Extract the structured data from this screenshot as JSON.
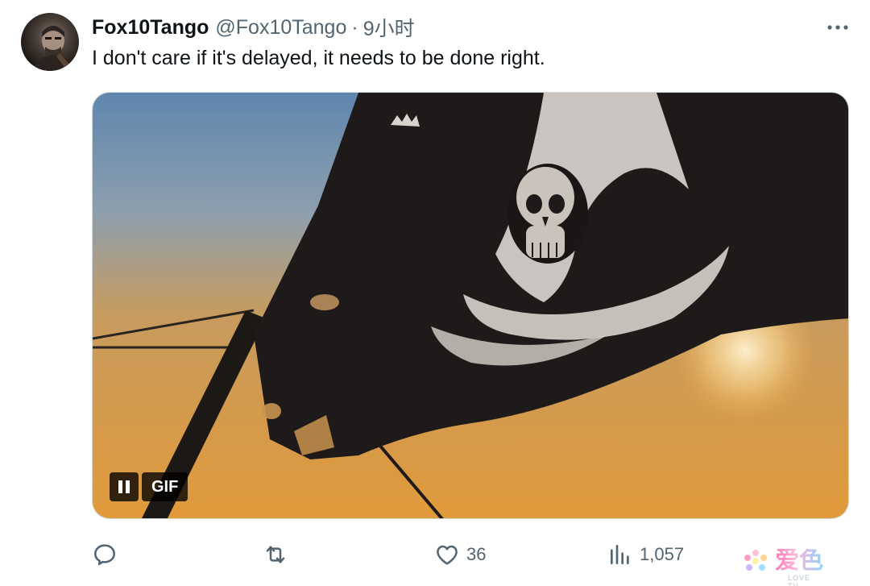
{
  "tweet": {
    "display_name": "Fox10Tango",
    "handle": "@Fox10Tango",
    "separator": "·",
    "time": "9小时",
    "text": "I don't care if it's delayed, it needs to be done right.",
    "media": {
      "kind": "GIF",
      "gif_label": "GIF",
      "playback_state": "playing"
    },
    "actions": {
      "reply": {
        "icon": "reply-icon",
        "count": ""
      },
      "retweet": {
        "icon": "retweet-icon",
        "count": ""
      },
      "like": {
        "icon": "heart-icon",
        "count": "36"
      },
      "views": {
        "icon": "views-bar-icon",
        "count": "1,057"
      }
    }
  },
  "watermark": {
    "text": "爱色",
    "sub": "LOVE TV"
  },
  "colors": {
    "text_primary": "#0f1419",
    "text_secondary": "#536471",
    "border": "#cfd9de",
    "watermark_pink": "#ff7ab6",
    "watermark_blue": "#8fd3ff"
  }
}
